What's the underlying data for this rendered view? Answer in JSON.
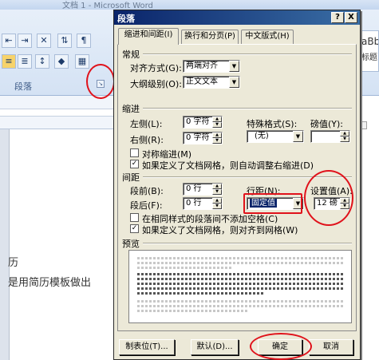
{
  "background": {
    "window_title": "文档 1 - Microsoft Word",
    "group_label": "段落",
    "style_preview": "aBb",
    "style_label": "标题",
    "doc_line1": "历",
    "doc_line2": "是用简历模板做出"
  },
  "dialog": {
    "title": "段落",
    "help": "?",
    "close": "X",
    "tabs": [
      {
        "label": "缩进和间距(I)"
      },
      {
        "label": "换行和分页(P)"
      },
      {
        "label": "中文版式(H)"
      }
    ],
    "general": {
      "heading": "常规",
      "alignment_label": "对齐方式(G):",
      "alignment_value": "两端对齐",
      "outline_label": "大纲级别(O):",
      "outline_value": "正文文本"
    },
    "indent": {
      "heading": "缩进",
      "left_label": "左侧(L):",
      "left_value": "0 字符",
      "right_label": "右侧(R):",
      "right_value": "0 字符",
      "special_label": "特殊格式(S):",
      "special_value": "(无)",
      "by_label": "磅值(Y):",
      "by_value": "",
      "mirror_label": "对称缩进(M)",
      "mirror_checked": false,
      "auto_adjust_label": "如果定义了文档网格，则自动调整右缩进(D)",
      "auto_adjust_checked": true
    },
    "spacing": {
      "heading": "间距",
      "before_label": "段前(B):",
      "before_value": "0 行",
      "after_label": "段后(F):",
      "after_value": "0 行",
      "line_label": "行距(N):",
      "line_value": "固定值",
      "at_label": "设置值(A):",
      "at_value": "12 磅",
      "no_space_label": "在相同样式的段落间不添加空格(C)",
      "no_space_checked": false,
      "snap_label": "如果定义了文档网格，则对齐到网格(W)",
      "snap_checked": true
    },
    "preview_heading": "预览",
    "buttons": {
      "tabs": "制表位(T)...",
      "default": "默认(D)...",
      "ok": "确定",
      "cancel": "取消"
    }
  },
  "colors": {
    "annotation": "#e0121b",
    "selection": "#0a246a"
  }
}
